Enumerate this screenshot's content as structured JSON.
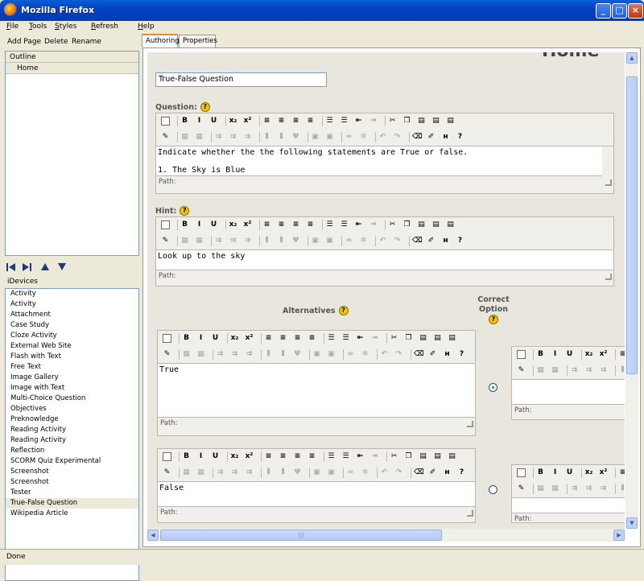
{
  "window": {
    "title": "Mozilla Firefox",
    "min_glyph": "_",
    "max_glyph": "□",
    "close_glyph": "×"
  },
  "menu": {
    "file": "File",
    "tools": "Tools",
    "styles": "Styles",
    "refresh": "Refresh",
    "help": "Help"
  },
  "left": {
    "add_page": "Add Page",
    "delete": "Delete",
    "rename": "Rename",
    "outline_header": "Outline",
    "outline_items": [
      "Home"
    ],
    "idevices_header": "iDevices",
    "idevices": [
      "Activity",
      "Activity",
      "Attachment",
      "Case Study",
      "Cloze Activity",
      "External Web Site",
      "Flash with Text",
      "Free Text",
      "Image Gallery",
      "Image with Text",
      "Multi-Choice Question",
      "Objectives",
      "Preknowledge",
      "Reading Activity",
      "Reading Activity",
      "Reflection",
      "SCORM Quiz Experimental",
      "Screenshot",
      "Screenshot",
      "Tester",
      "True-False Question",
      "Wikipedia Article"
    ],
    "selected_idevice": "True-False Question"
  },
  "tabs": {
    "authoring": "Authoring",
    "properties": "Properties"
  },
  "page_heading": "Home",
  "idevice_title": "True-False Question",
  "question": {
    "label": "Question:",
    "line1": "Indicate whether the the following statements are True or false.",
    "line2": "1. The Sky is Blue",
    "path": "Path:"
  },
  "hint": {
    "label": "Hint:",
    "text": "Look up to the sky",
    "path": "Path:"
  },
  "alternatives": {
    "label": "Alternatives",
    "correct_label_1": "Correct",
    "correct_label_2": "Option",
    "items": [
      {
        "text": "True",
        "path": "Path:",
        "correct": true
      },
      {
        "text": "False",
        "path": "Path:",
        "correct": false
      }
    ]
  },
  "help_glyph": "?",
  "status": "Done",
  "colors": {
    "titlebar": "#0441c2",
    "accent_tab": "#e68b2c",
    "panel": "#ece9d8"
  }
}
